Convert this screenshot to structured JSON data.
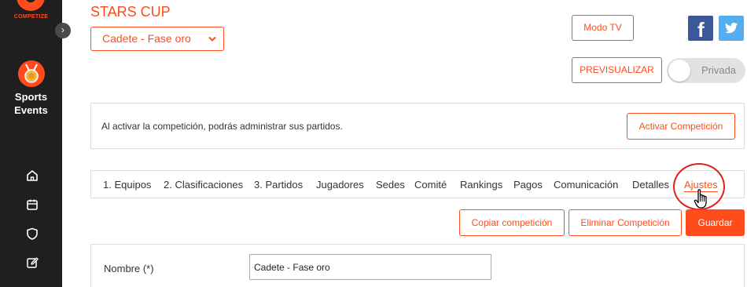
{
  "sidebar": {
    "brand": "COMPETIZE",
    "collapse_glyph": "›",
    "section_line1": "Sports",
    "section_line2": "Events",
    "nav_icons": [
      "home-icon",
      "calendar-icon",
      "shield-icon",
      "edit-icon"
    ]
  },
  "header": {
    "title": "STARS CUP",
    "phase_selected": "Cadete - Fase oro",
    "tv_mode_label": "Modo TV",
    "preview_label": "PREVISUALIZAR",
    "privacy_toggle_label": "Privada",
    "privacy_on": false,
    "facebook_glyph": "f"
  },
  "activation": {
    "message": "Al activar la competición, podrás administrar sus partidos.",
    "button_label": "Activar Competición"
  },
  "tabs": [
    {
      "label": "1. Equipos"
    },
    {
      "label": "2. Clasificaciones"
    },
    {
      "label": "3. Partidos"
    },
    {
      "label": "Jugadores"
    },
    {
      "label": "Sedes"
    },
    {
      "label": "Comité"
    },
    {
      "label": "Rankings"
    },
    {
      "label": "Pagos"
    },
    {
      "label": "Comunicación"
    },
    {
      "label": "Detalles"
    },
    {
      "label": "Ajustes",
      "active": true
    }
  ],
  "actions": {
    "copy_label": "Copiar competición",
    "delete_label": "Eliminar Competición",
    "save_label": "Guardar"
  },
  "form": {
    "name_label": "Nombre (*)",
    "name_value": "Cadete - Fase oro"
  },
  "colors": {
    "accent": "#ff4c1c",
    "sidebar_bg": "#1f1f1f",
    "facebook": "#3b5998",
    "twitter": "#55acee"
  }
}
